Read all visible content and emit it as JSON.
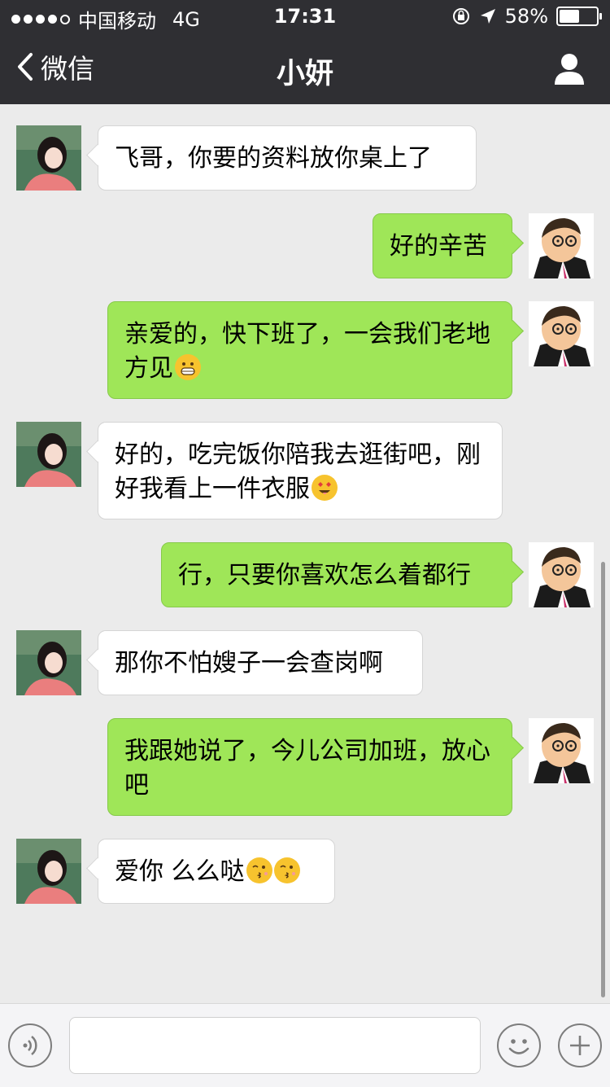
{
  "status": {
    "carrier": "中国移动",
    "network": "4G",
    "time": "17:31",
    "battery": "58%",
    "battery_level": 0.58
  },
  "nav": {
    "back_label": "微信",
    "title": "小妍"
  },
  "messages": [
    {
      "side": "in",
      "text": "飞哥，你要的资料放你桌上了",
      "emojis": []
    },
    {
      "side": "out",
      "text": "好的辛苦",
      "emojis": []
    },
    {
      "side": "out",
      "text": "亲爱的，快下班了，一会我们老地方见",
      "emojis": [
        "grinning-face-emoji"
      ]
    },
    {
      "side": "in",
      "text": "好的，吃完饭你陪我去逛街吧，刚好我看上一件衣服",
      "emojis": [
        "heart-eyes-emoji"
      ]
    },
    {
      "side": "out",
      "text": "行，只要你喜欢怎么着都行",
      "emojis": []
    },
    {
      "side": "in",
      "text": "那你不怕嫂子一会查岗啊",
      "emojis": []
    },
    {
      "side": "out",
      "text": "我跟她说了，今儿公司加班，放心吧",
      "emojis": []
    },
    {
      "side": "in",
      "text": "爱你 么么哒",
      "emojis": [
        "kissing-face-emoji",
        "kissing-face-emoji"
      ]
    }
  ],
  "icons": {
    "back": "chevron-left-icon",
    "profile": "person-icon",
    "voice": "voice-icon",
    "emoji": "smiley-icon",
    "plus": "plus-icon"
  },
  "colors": {
    "header": "#2f2f33",
    "out_bubble": "#9fe658",
    "in_bubble": "#ffffff",
    "chat_bg": "#ebebeb"
  }
}
